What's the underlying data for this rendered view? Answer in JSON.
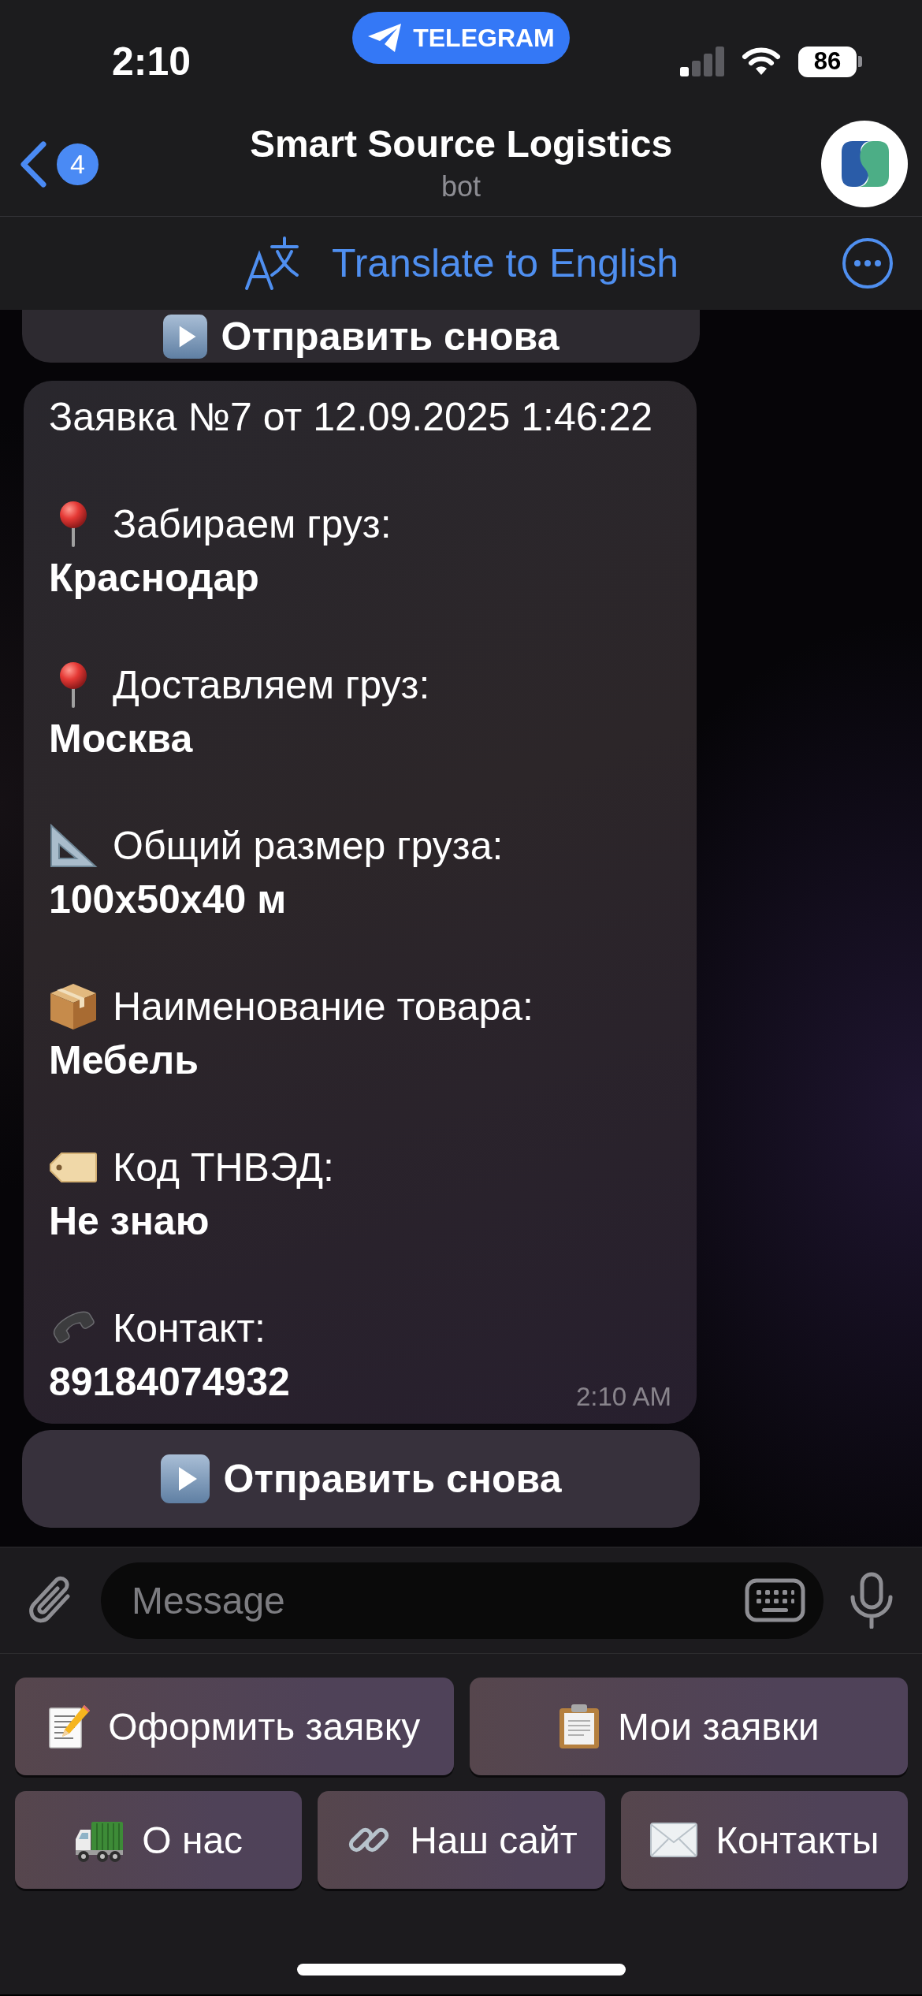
{
  "status_bar": {
    "time": "2:10",
    "app_pill": "TELEGRAM",
    "battery": "86"
  },
  "header": {
    "unread_count": "4",
    "title": "Smart Source Logistics",
    "subtitle": "bot"
  },
  "translate_bar": {
    "label": "Translate to English"
  },
  "chat": {
    "previous_button": {
      "kind": "play",
      "label": "Отправить снова"
    },
    "message": {
      "title": "Заявка №7 от 12.09.2025 1:46:22",
      "fields": [
        {
          "kind": "pin",
          "label": "Забираем груз:",
          "value": "Краснодар"
        },
        {
          "kind": "pin",
          "label": "Доставляем груз:",
          "value": "Москва"
        },
        {
          "kind": "ruler",
          "label": "Общий размер груза:",
          "value": "100x50x40 м"
        },
        {
          "kind": "box",
          "label": "Наименование товара:",
          "value": "Мебель"
        },
        {
          "kind": "tag",
          "label": "Код ТНВЭД:",
          "value": "Не знаю"
        },
        {
          "kind": "phone",
          "label": "Контакт:",
          "value": "89184074932"
        }
      ],
      "time": "2:10 AM"
    },
    "inline_button": {
      "kind": "play",
      "label": "Отправить снова"
    }
  },
  "composer": {
    "placeholder": "Message"
  },
  "keyboard": {
    "top_row": [
      {
        "kind": "notepad",
        "label": "Оформить заявку"
      },
      {
        "kind": "clipboard",
        "label": "Мои заявки"
      }
    ],
    "bottom_row": [
      {
        "kind": "truck",
        "label": "О нас"
      },
      {
        "kind": "link",
        "label": "Наш сайт"
      },
      {
        "kind": "envelope",
        "label": "Контакты"
      }
    ]
  }
}
